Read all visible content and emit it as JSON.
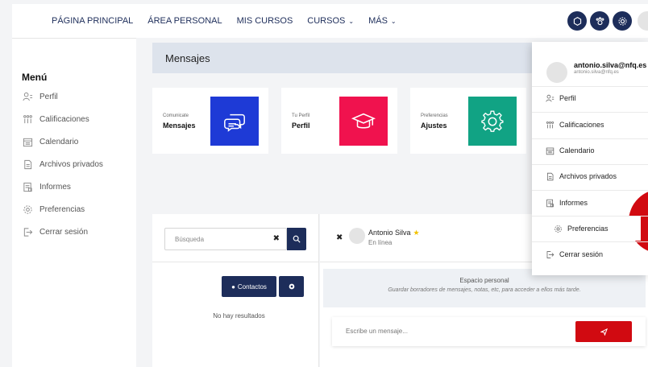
{
  "nav": {
    "items": [
      {
        "label": "PÁGINA PRINCIPAL",
        "caret": false
      },
      {
        "label": "ÁREA PERSONAL",
        "caret": false
      },
      {
        "label": "MIS CURSOS",
        "caret": false
      },
      {
        "label": "CURSOS",
        "caret": true
      },
      {
        "label": "MÁS",
        "caret": true
      }
    ],
    "icons": [
      "puzzle-icon",
      "paw-icon",
      "gear-icon"
    ]
  },
  "sidebar": {
    "title": "Menú",
    "items": [
      {
        "label": "Perfil",
        "icon": "profile-icon"
      },
      {
        "label": "Calificaciones",
        "icon": "grades-icon"
      },
      {
        "label": "Calendario",
        "icon": "calendar-icon"
      },
      {
        "label": "Archivos privados",
        "icon": "file-icon"
      },
      {
        "label": "Informes",
        "icon": "report-icon"
      },
      {
        "label": "Preferencias",
        "icon": "gear-icon"
      },
      {
        "label": "Cerrar sesión",
        "icon": "logout-icon"
      }
    ]
  },
  "page": {
    "title": "Mensajes"
  },
  "cards": [
    {
      "small": "Comunicate",
      "big": "Mensajes",
      "color": "#1e3ad6",
      "icon": "chat-icon"
    },
    {
      "small": "Tu Perfil",
      "big": "Perfil",
      "color": "#f0124e",
      "icon": "graduation-cap-icon"
    },
    {
      "small": "Preferencias",
      "big": "Ajustes",
      "color": "#11a384",
      "icon": "gear-icon"
    }
  ],
  "messaging": {
    "search_placeholder": "Búsqueda",
    "contacts_label": "Contactos",
    "no_results": "No hay resultados",
    "contact_name": "Antonio Silva",
    "contact_status": "En línea",
    "self_title": "Espacio personal",
    "self_desc": "Guardar borradores de mensajes, notas, etc, para acceder a ellos más tarde.",
    "message_placeholder": "Escribe un mensaje..."
  },
  "dropdown": {
    "user": "antonio.silva@nfq.es",
    "email": "antonio.silva@nfq.es",
    "items": [
      {
        "label": "Perfil",
        "icon": "profile-icon"
      },
      {
        "label": "Calificaciones",
        "icon": "grades-icon"
      },
      {
        "label": "Calendario",
        "icon": "calendar-icon"
      },
      {
        "label": "Archivos privados",
        "icon": "file-icon"
      },
      {
        "label": "Informes",
        "icon": "report-icon"
      },
      {
        "label": "Preferencias",
        "icon": "gear-icon"
      },
      {
        "label": "Cerrar sesión",
        "icon": "logout-icon"
      }
    ]
  },
  "colors": {
    "navy": "#1d2d5a",
    "red": "#d10a11"
  }
}
